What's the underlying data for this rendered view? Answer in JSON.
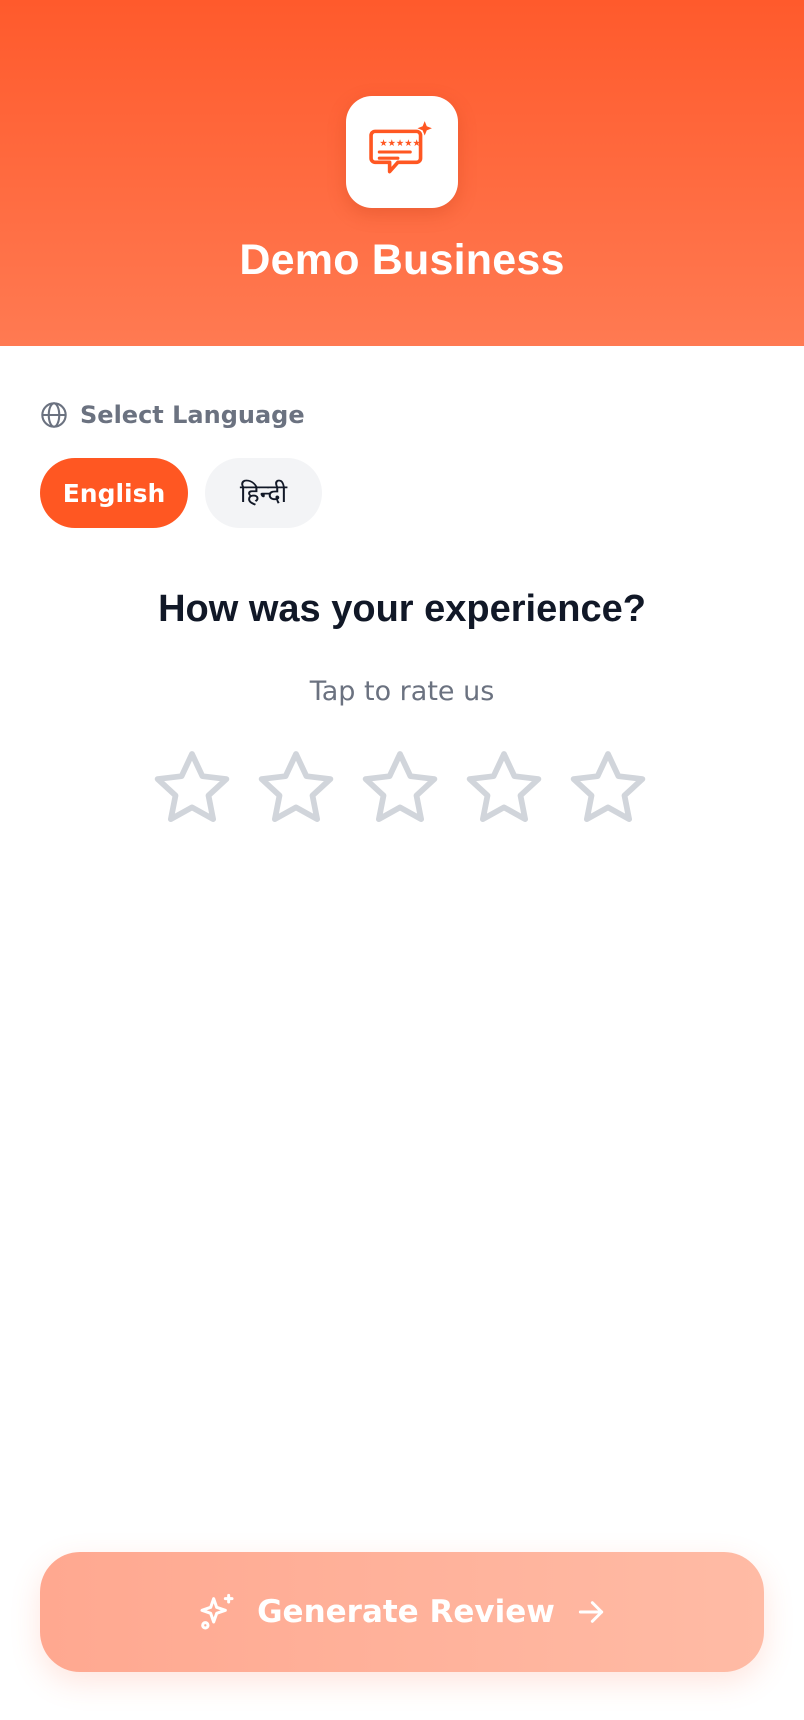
{
  "header": {
    "business_name": "Demo Business",
    "logo_icon": "review-chat-icon",
    "gradient_top": "#ff5a2c",
    "gradient_bottom": "#ff7a52"
  },
  "language": {
    "label": "Select Language",
    "icon": "globe-icon",
    "options": [
      {
        "label": "English",
        "selected": true
      },
      {
        "label": "हिन्दी",
        "selected": false
      }
    ],
    "accent": "#ff5722"
  },
  "rating": {
    "question": "How was your experience?",
    "subtitle": "Tap to rate us",
    "max_stars": 5,
    "value": 0,
    "star_color": "#d1d5db"
  },
  "action": {
    "button_label": "Generate Review",
    "leading_icon": "sparkles-icon",
    "trailing_icon": "arrow-right-icon",
    "enabled": false
  }
}
